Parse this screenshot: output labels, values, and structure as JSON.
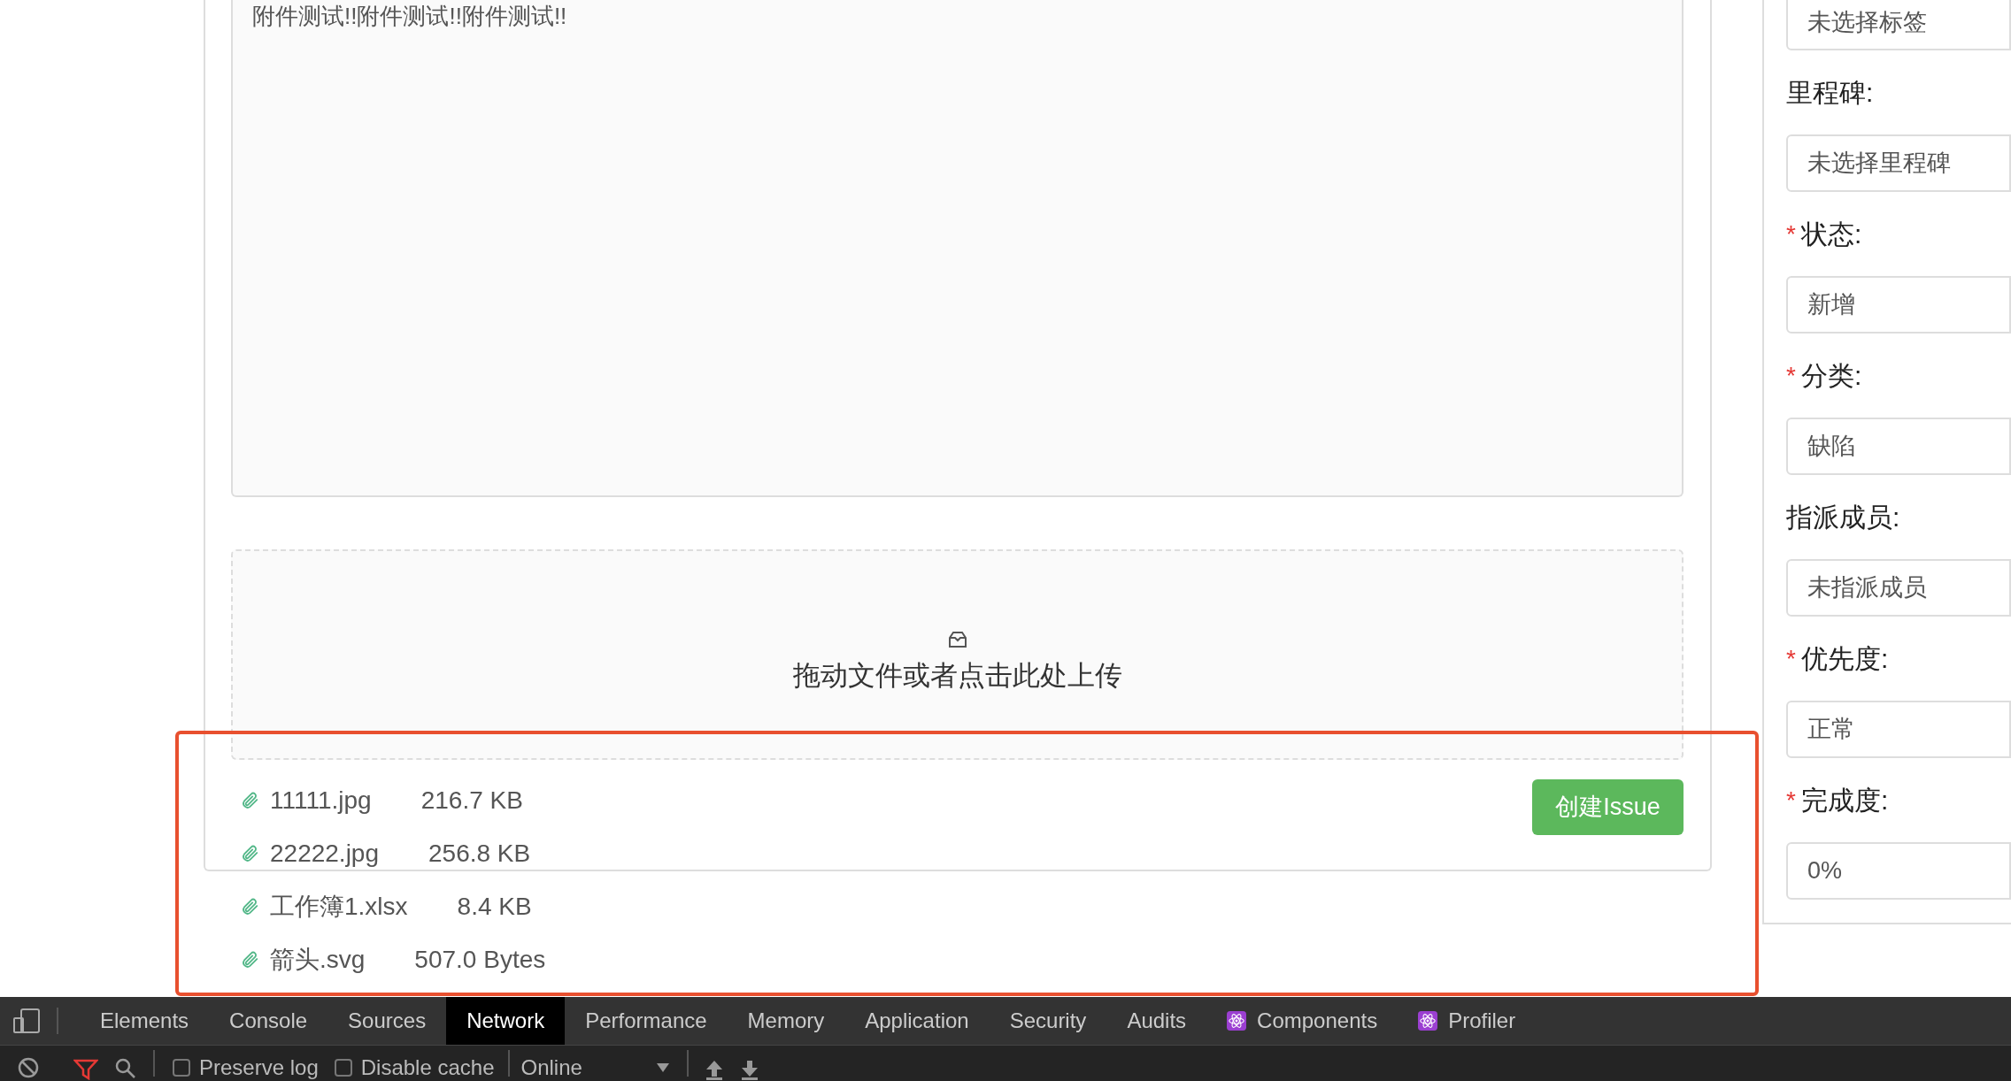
{
  "editor": {
    "value": "附件测试!!附件测试!!附件测试!!"
  },
  "upload": {
    "hint": "拖动文件或者点击此处上传"
  },
  "files": [
    {
      "name": "11111.jpg",
      "size": "216.7 KB"
    },
    {
      "name": "22222.jpg",
      "size": "256.8 KB"
    },
    {
      "name": "工作簿1.xlsx",
      "size": "8.4 KB"
    },
    {
      "name": "箭头.svg",
      "size": "507.0 Bytes"
    }
  ],
  "submit_button": "创建Issue",
  "sidebar": {
    "top_field": "未选择标签",
    "required_mark": "*",
    "fields": [
      {
        "label": "里程碑:",
        "required": false,
        "value": "未选择里程碑"
      },
      {
        "label": "状态:",
        "required": true,
        "value": "新增"
      },
      {
        "label": "分类:",
        "required": true,
        "value": "缺陷"
      },
      {
        "label": "指派成员:",
        "required": false,
        "value": "未指派成员"
      },
      {
        "label": "优先度:",
        "required": true,
        "value": "正常"
      },
      {
        "label": "完成度:",
        "required": true,
        "value": "0%"
      }
    ]
  },
  "devtools": {
    "tabs": [
      {
        "label": "Elements",
        "selected": false,
        "kind": "plain"
      },
      {
        "label": "Console",
        "selected": false,
        "kind": "plain"
      },
      {
        "label": "Sources",
        "selected": false,
        "kind": "plain"
      },
      {
        "label": "Network",
        "selected": true,
        "kind": "plain"
      },
      {
        "label": "Performance",
        "selected": false,
        "kind": "plain"
      },
      {
        "label": "Memory",
        "selected": false,
        "kind": "plain"
      },
      {
        "label": "Application",
        "selected": false,
        "kind": "plain"
      },
      {
        "label": "Security",
        "selected": false,
        "kind": "plain"
      },
      {
        "label": "Audits",
        "selected": false,
        "kind": "plain"
      },
      {
        "label": "Components",
        "selected": false,
        "kind": "react"
      },
      {
        "label": "Profiler",
        "selected": false,
        "kind": "react"
      }
    ],
    "options": [
      {
        "label": "Preserve log",
        "checked": false
      },
      {
        "label": "Disable cache",
        "checked": false
      }
    ],
    "throttle": "Online"
  }
}
